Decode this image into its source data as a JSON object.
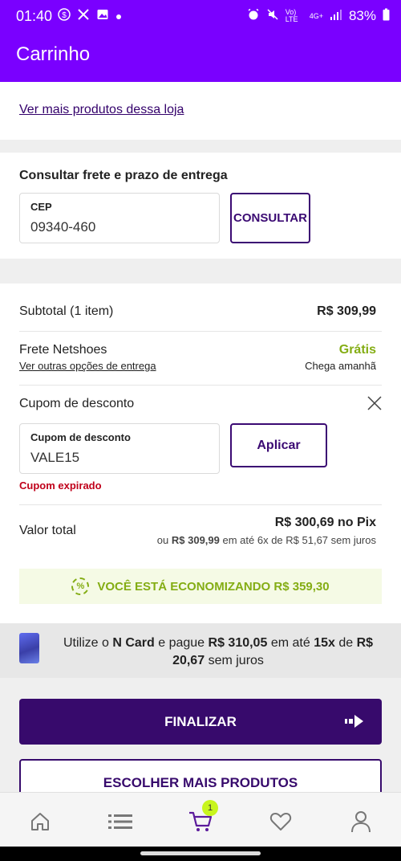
{
  "status_bar": {
    "time": "01:40",
    "battery": "83%",
    "net_label": "Vo) LTE",
    "net_type": "4G+",
    "left_icons": [
      "dollar-circle-icon",
      "x-logo-icon",
      "image-icon",
      "dot-icon"
    ],
    "right_icons": [
      "alarm-icon",
      "mute-icon",
      "signal-icon",
      "battery-icon"
    ]
  },
  "header": {
    "title": "Carrinho"
  },
  "store_link": "Ver mais produtos dessa loja",
  "shipping": {
    "heading": "Consultar frete e prazo de entrega",
    "cep_label": "CEP",
    "cep_value": "09340-460",
    "consult_button": "CONSULTAR"
  },
  "summary": {
    "subtotal_label": "Subtotal (1 item)",
    "subtotal_value": "R$ 309,99",
    "shipping_label": "Frete Netshoes",
    "shipping_value": "Grátis",
    "shipping_link": "Ver outras opções de entrega",
    "shipping_eta": "Chega amanhã",
    "coupon_heading": "Cupom de desconto",
    "coupon_field_label": "Cupom de desconto",
    "coupon_value": "VALE15",
    "apply_button": "Aplicar",
    "coupon_error": "Cupom expirado",
    "total_label": "Valor total",
    "total_pix": "R$ 300,69 no Pix",
    "total_or": "ou",
    "total_full": "R$ 309,99",
    "total_installments": "em até 6x de R$ 51,67 sem juros",
    "saving_text": "VOCÊ ESTÁ ECONOMIZANDO R$ 359,30",
    "saving_pct_icon": "%"
  },
  "ncard": {
    "pre": "Utilize o",
    "brand": "N Card",
    "mid": "e pague",
    "amount": "R$ 310,05",
    "mid2": "em até",
    "times": "15x",
    "mid3": "de",
    "installment": "R$ 20,67",
    "post": "sem juros"
  },
  "actions": {
    "finalize": "FINALIZAR",
    "more_products": "ESCOLHER MAIS PRODUTOS"
  },
  "bottom_nav": {
    "cart_badge": "1",
    "items": [
      "home-icon",
      "list-icon",
      "cart-icon",
      "heart-icon",
      "profile-icon"
    ]
  },
  "colors": {
    "brand_purple": "#7a00ff",
    "dark_purple": "#370a6c",
    "green": "#84ad14",
    "error_red": "#c0001a"
  }
}
